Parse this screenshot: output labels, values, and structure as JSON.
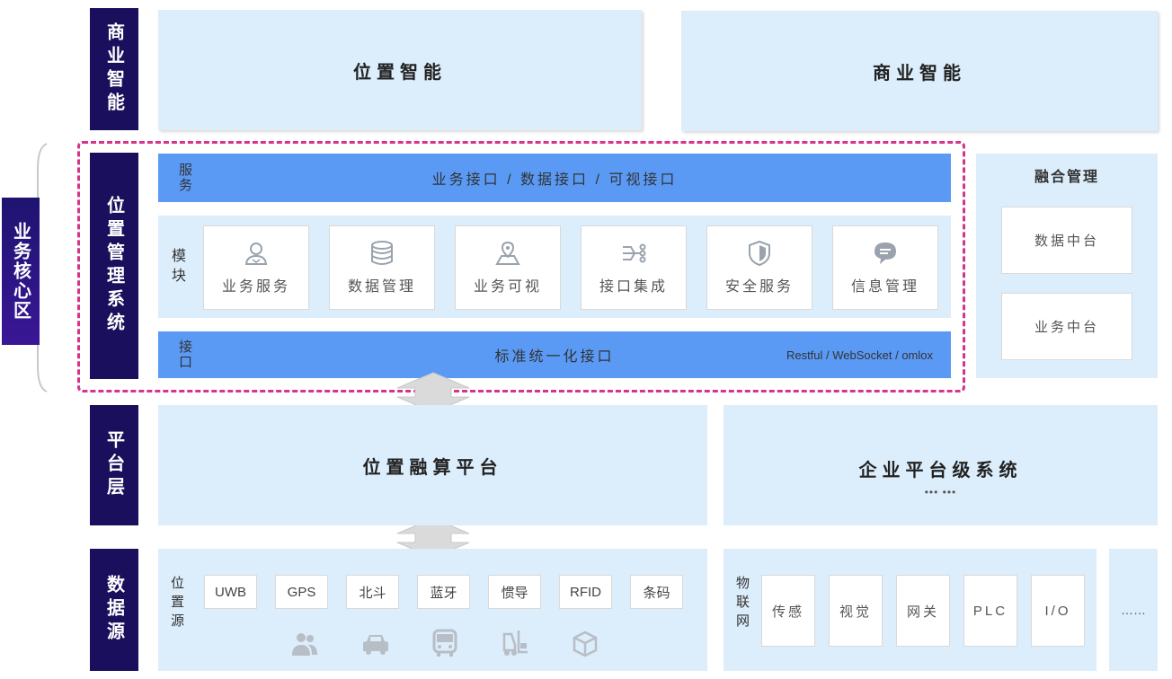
{
  "layers": {
    "business": "商业智能",
    "location_mgmt": "位置管理系统",
    "platform": "平台层",
    "data_source": "数据源"
  },
  "core_zone": "业务核心区",
  "top": {
    "location_intel": "位置智能",
    "business_intel": "商业智能"
  },
  "service_bar": {
    "label": "服务",
    "text": "业务接口 / 数据接口 / 可视接口"
  },
  "modules": {
    "label": "模块",
    "items": [
      {
        "label": "业务服务",
        "icon": "user-service-icon"
      },
      {
        "label": "数据管理",
        "icon": "database-icon"
      },
      {
        "label": "业务可视",
        "icon": "map-pin-icon"
      },
      {
        "label": "接口集成",
        "icon": "integration-icon"
      },
      {
        "label": "安全服务",
        "icon": "shield-icon"
      },
      {
        "label": "信息管理",
        "icon": "message-icon"
      }
    ]
  },
  "interface_bar": {
    "label": "接口",
    "text": "标准统一化接口",
    "protocols": "Restful / WebSocket / omlox"
  },
  "fusion_mgmt": {
    "title": "融合管理",
    "items": [
      "数据中台",
      "业务中台"
    ]
  },
  "platform": {
    "location_platform": "位置融算平台",
    "enterprise": "企业平台级系统",
    "enterprise_more": "••• •••"
  },
  "location_source": {
    "label": "位置源",
    "chips": [
      "UWB",
      "GPS",
      "北斗",
      "蓝牙",
      "惯导",
      "RFID",
      "条码"
    ],
    "icons": [
      "people-icon",
      "car-icon",
      "bus-icon",
      "forklift-icon",
      "package-icon"
    ]
  },
  "iot": {
    "label": "物联网",
    "items": [
      "传感",
      "视觉",
      "网关",
      "PLC",
      "I/O"
    ]
  },
  "more": "……",
  "colors": {
    "sidebar": "#1a0f5c",
    "panel": "#dcedfb",
    "bar": "#5a9af5",
    "dashed": "#d6338c",
    "icon": "#9aa3ad"
  }
}
